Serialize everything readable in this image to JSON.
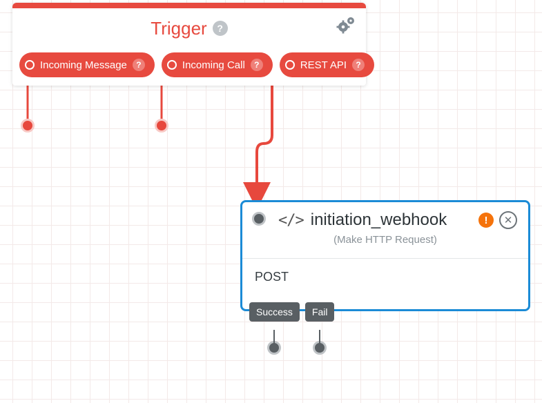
{
  "trigger": {
    "title": "Trigger",
    "events": [
      {
        "label": "Incoming Message"
      },
      {
        "label": "Incoming Call"
      },
      {
        "label": "REST API"
      }
    ]
  },
  "webhook": {
    "title": "initiation_webhook",
    "subtitle": "(Make HTTP Request)",
    "method": "POST",
    "outputs": [
      {
        "label": "Success"
      },
      {
        "label": "Fail"
      }
    ]
  },
  "colors": {
    "red": "#e74a3f",
    "blue": "#1b8bd6",
    "grey": "#595f63",
    "orange": "#f5730b"
  }
}
